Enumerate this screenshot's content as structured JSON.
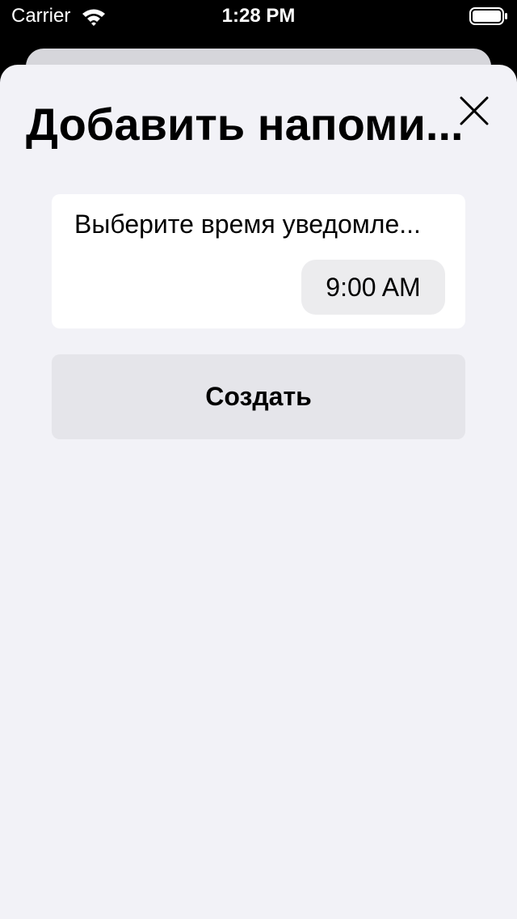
{
  "status_bar": {
    "carrier": "Carrier",
    "time": "1:28 PM",
    "wifi_icon": "wifi-icon",
    "battery_icon": "battery-icon"
  },
  "sheet": {
    "close_icon": "close-icon",
    "title": "Добавить напоми...",
    "card": {
      "label": "Выберите время уведомле...",
      "time_value": "9:00 AM"
    },
    "create_button_label": "Создать"
  },
  "colors": {
    "sheet_background": "#f2f2f7",
    "card_background": "#ffffff",
    "button_background": "#e5e5ea",
    "time_pill_background": "#ececee",
    "status_bar_background": "#000000"
  }
}
